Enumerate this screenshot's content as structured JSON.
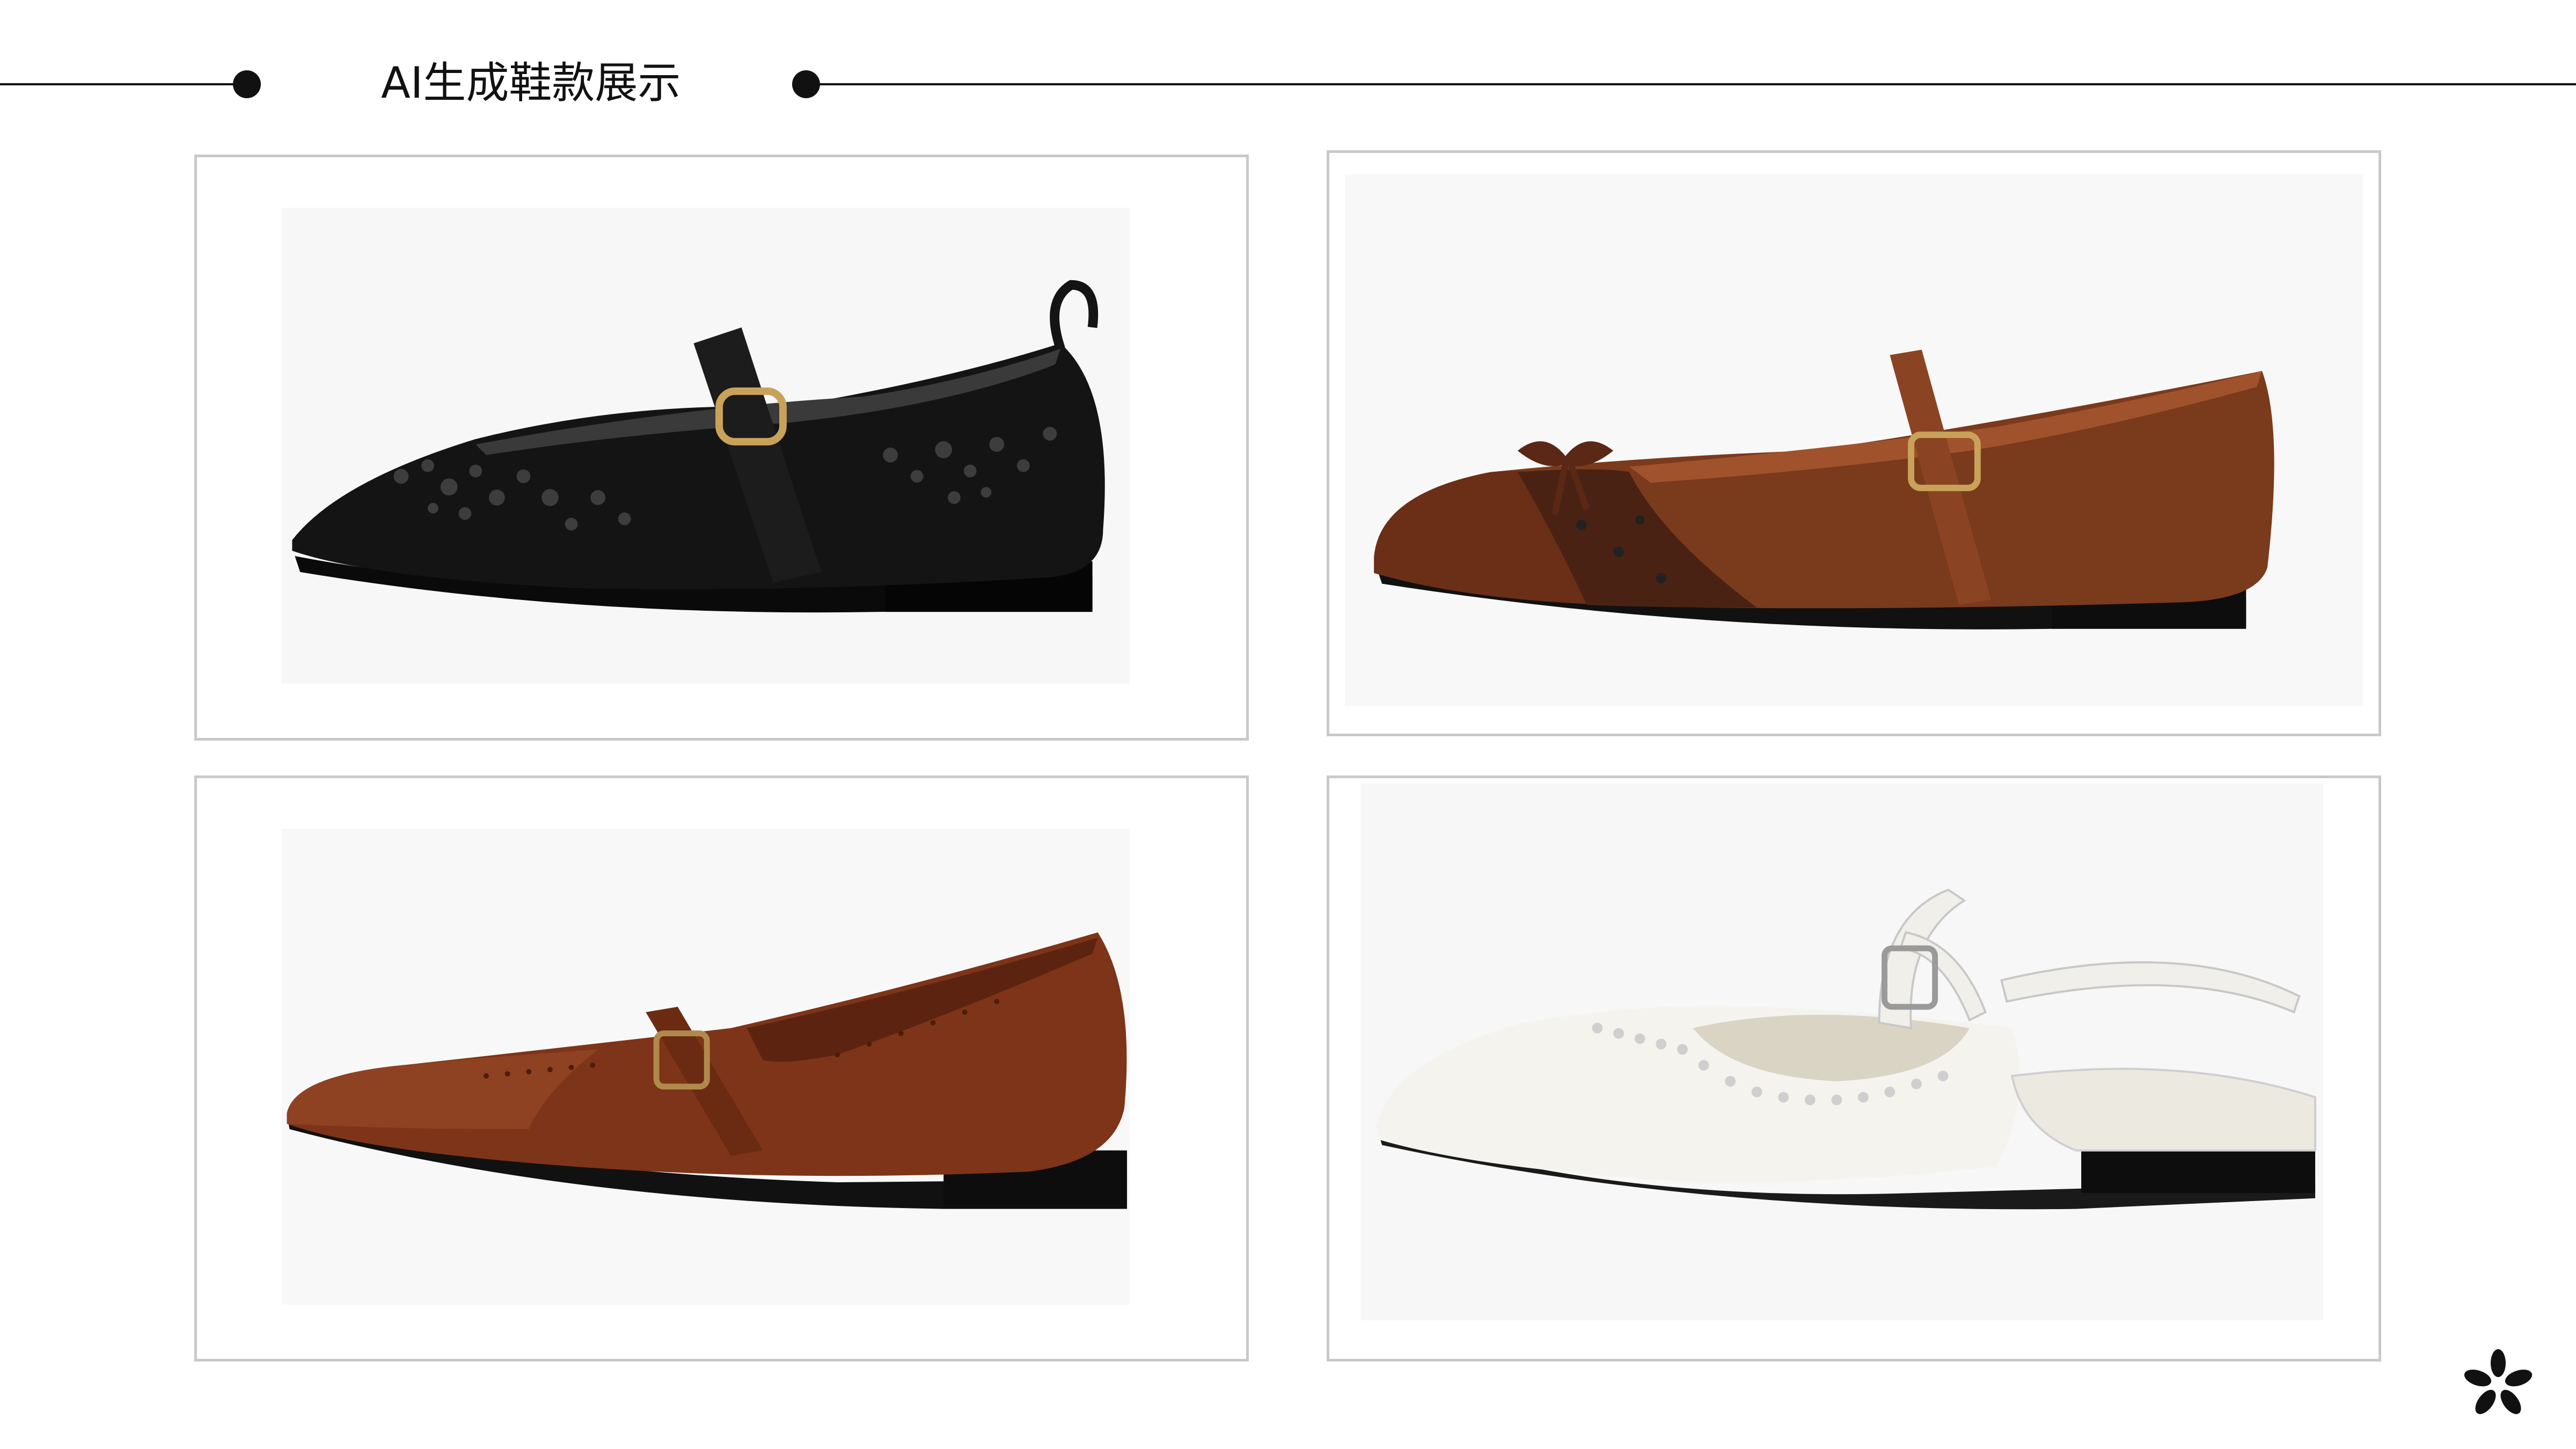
{
  "slide": {
    "title": "AI生成鞋款展示"
  },
  "gallery": {
    "items": [
      {
        "shoe_color": "#141414",
        "accent": "#c9a25a"
      },
      {
        "shoe_color": "#7a3a1c",
        "accent": "#c9a25a"
      },
      {
        "shoe_color": "#7e3418",
        "accent": "#b08a4c"
      },
      {
        "shoe_color": "#f4f3ee",
        "accent": "#9a9a9a"
      }
    ]
  },
  "brand": {
    "icon": "asterisk-flower-icon",
    "color": "#111111"
  }
}
